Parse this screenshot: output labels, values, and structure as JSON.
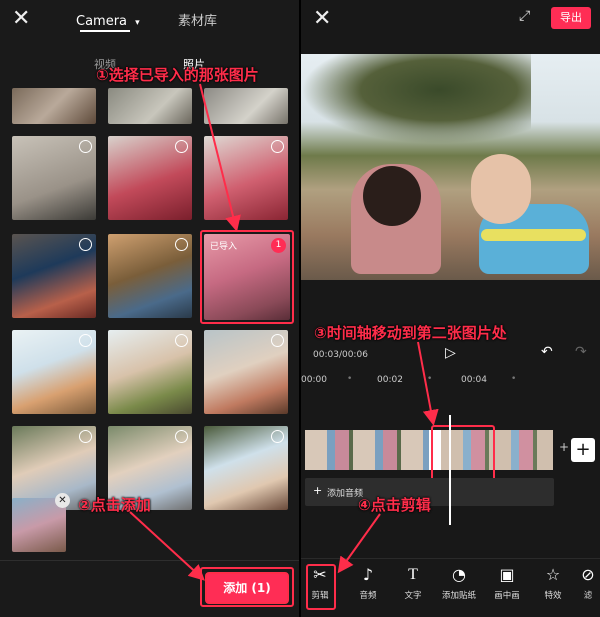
{
  "left": {
    "tabs": {
      "camera": "Camera",
      "material": "素材库"
    },
    "subtabs": {
      "video": "视频",
      "photo": "照片"
    },
    "imported_badge": "已导入",
    "selected_count": "1",
    "add_button": "添加 (1)"
  },
  "right": {
    "export_button": "导出",
    "time_current": "00:03",
    "time_total": "00:06",
    "ruler": [
      "00:00",
      "00:02",
      "00:04"
    ],
    "add_audio": "添加音频",
    "toolbar": [
      {
        "label": "剪辑",
        "icon": "scissors-icon"
      },
      {
        "label": "音频",
        "icon": "music-note-icon"
      },
      {
        "label": "文字",
        "icon": "text-icon"
      },
      {
        "label": "添加贴纸",
        "icon": "sticker-icon"
      },
      {
        "label": "画中画",
        "icon": "pip-icon"
      },
      {
        "label": "特效",
        "icon": "effects-icon"
      },
      {
        "label": "滤",
        "icon": "filter-icon"
      }
    ]
  },
  "annotations": {
    "step1": "①选择已导入的那张图片",
    "step2": "②点击添加",
    "step3": "③时间轴移动到第二张图片处",
    "step4": "④点击剪辑"
  },
  "colors": {
    "accent": "#ff2d55",
    "annotation": "#ff2d4a",
    "background": "#1a1a1a"
  }
}
